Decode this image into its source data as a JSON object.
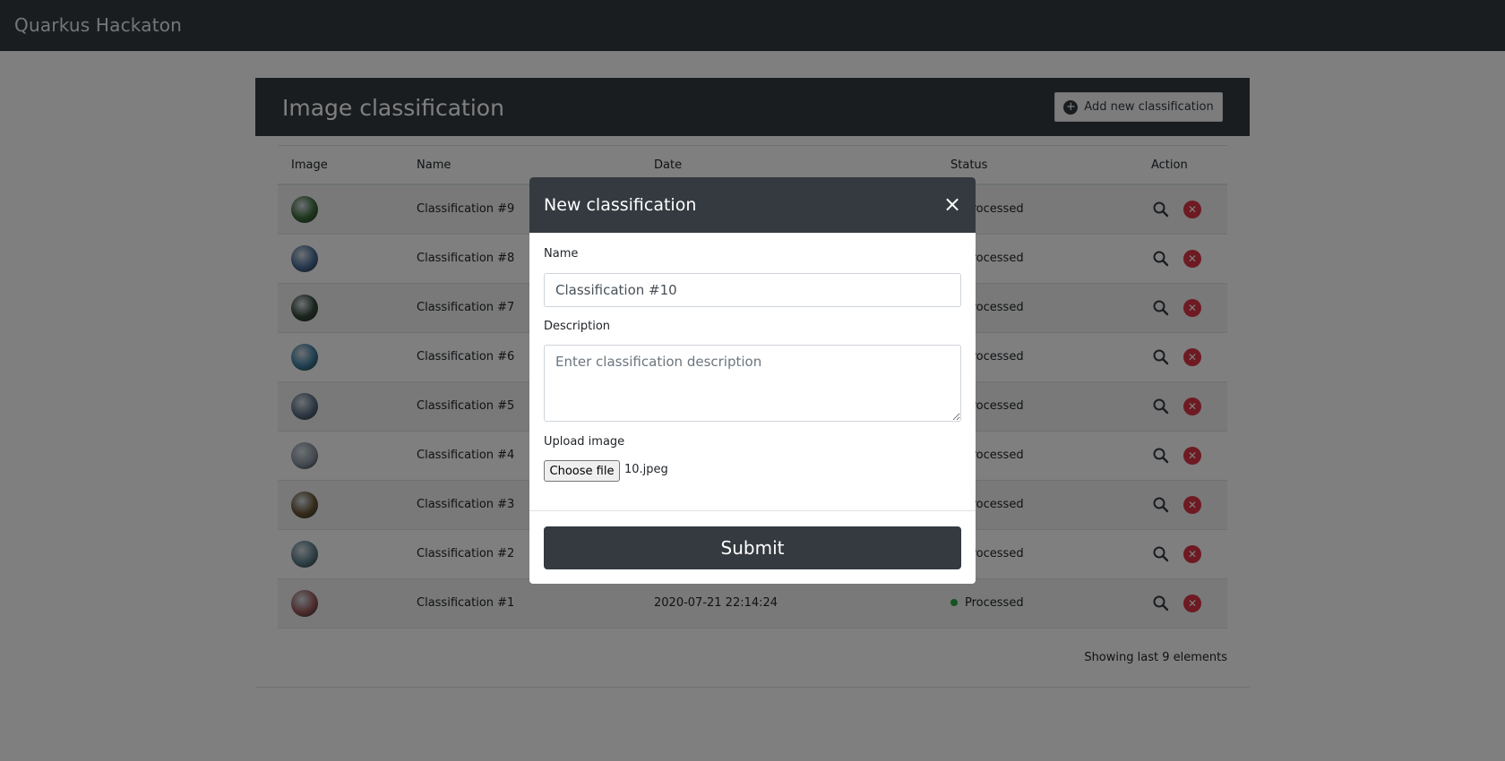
{
  "navbar": {
    "brand": "Quarkus Hackaton"
  },
  "card": {
    "title": "Image classification",
    "add_button": "Add new classification"
  },
  "table": {
    "headers": {
      "image": "Image",
      "name": "Name",
      "date": "Date",
      "status": "Status",
      "action": "Action"
    },
    "rows": [
      {
        "name": "Classification #9",
        "date": "",
        "status": "Processed",
        "thumb_color": "#3d6b3a"
      },
      {
        "name": "Classification #8",
        "date": "",
        "status": "Processed",
        "thumb_color": "#4a6d9a"
      },
      {
        "name": "Classification #7",
        "date": "",
        "status": "Processed",
        "thumb_color": "#36473a"
      },
      {
        "name": "Classification #6",
        "date": "",
        "status": "Processed",
        "thumb_color": "#3f7ea1"
      },
      {
        "name": "Classification #5",
        "date": "",
        "status": "Processed",
        "thumb_color": "#5b6f86"
      },
      {
        "name": "Classification #4",
        "date": "",
        "status": "Processed",
        "thumb_color": "#8a96a3"
      },
      {
        "name": "Classification #3",
        "date": "",
        "status": "Processed",
        "thumb_color": "#6b5534"
      },
      {
        "name": "Classification #2",
        "date": "",
        "status": "Processed",
        "thumb_color": "#5c7f8c"
      },
      {
        "name": "Classification #1",
        "date": "2020-07-21 22:14:24",
        "status": "Processed",
        "thumb_color": "#9c5a5c"
      }
    ],
    "footer": "Showing last 9 elements"
  },
  "modal": {
    "title": "New classification",
    "close": "×",
    "name_label": "Name",
    "name_value": "Classification #10",
    "description_label": "Description",
    "description_placeholder": "Enter classification description",
    "upload_label": "Upload image",
    "choose_file": "Choose file",
    "file_name": "10.jpeg",
    "submit": "Submit"
  },
  "icons": {
    "add": "plus-circle-icon",
    "search": "search-icon",
    "delete": "close-circle-icon"
  },
  "colors": {
    "dark": "#343a40",
    "status_ok": "#28a745",
    "delete": "#dc3545"
  }
}
